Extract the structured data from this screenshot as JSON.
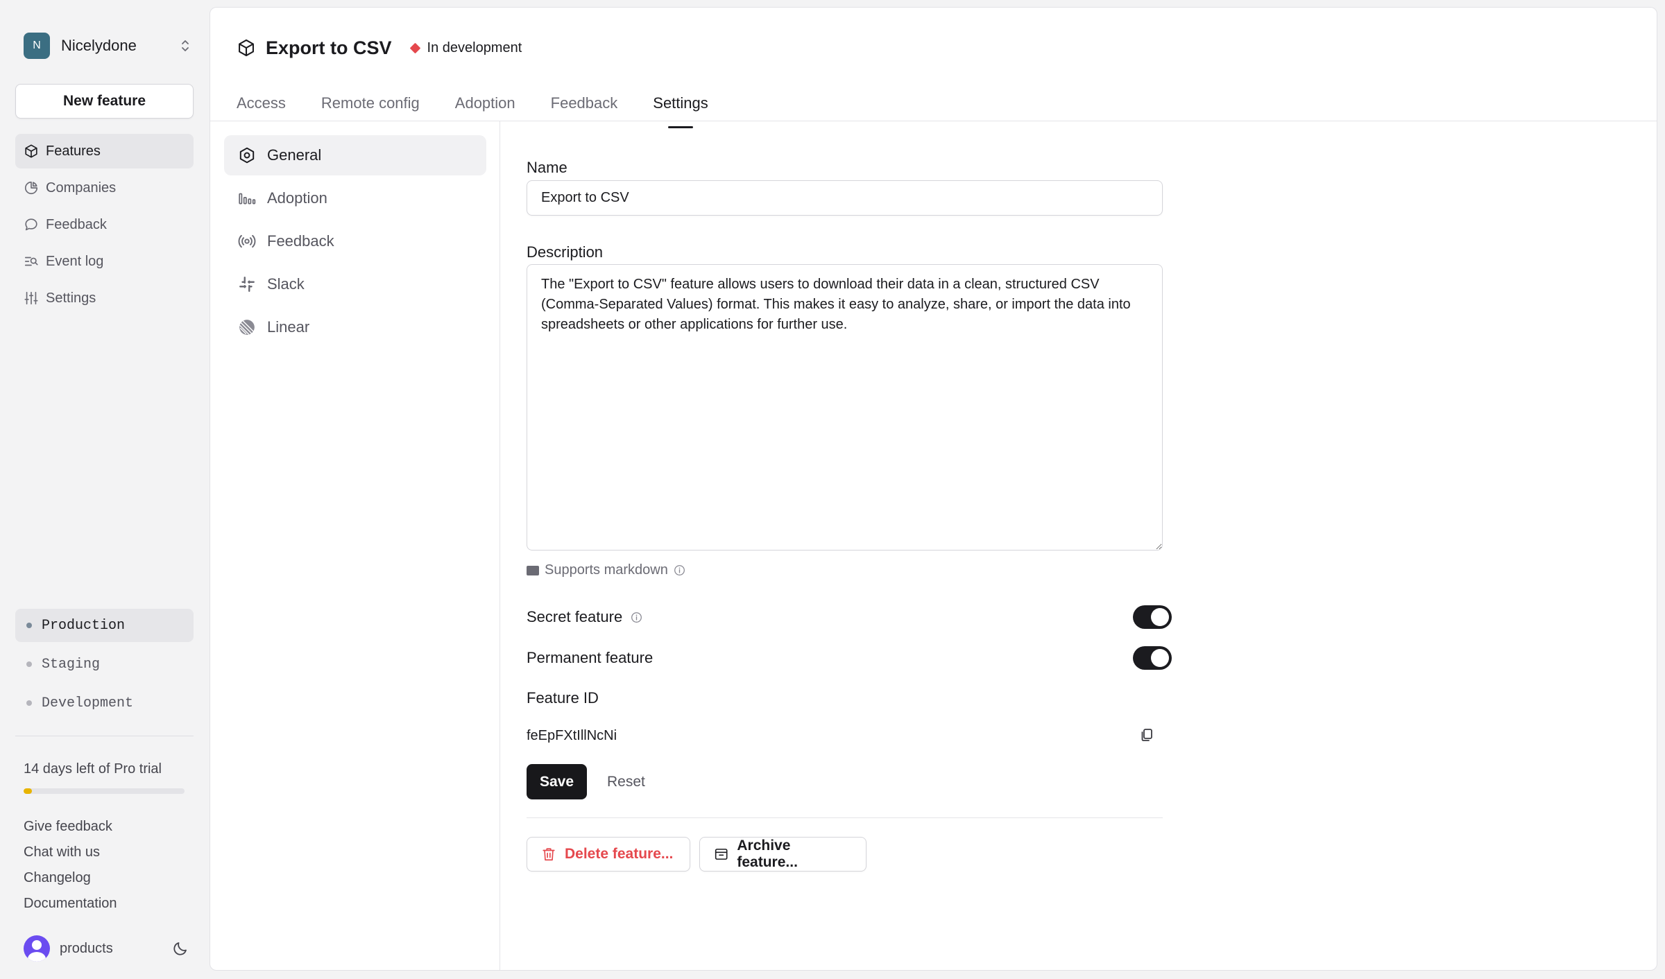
{
  "workspace": {
    "initial": "N",
    "name": "Nicelydone"
  },
  "sidebar": {
    "new_feature_label": "New feature",
    "nav": [
      {
        "label": "Features",
        "icon": "cube-icon",
        "active": true
      },
      {
        "label": "Companies",
        "icon": "pie-chart-icon"
      },
      {
        "label": "Feedback",
        "icon": "chat-bubble-icon"
      },
      {
        "label": "Event log",
        "icon": "event-log-icon"
      },
      {
        "label": "Settings",
        "icon": "sliders-icon"
      }
    ],
    "environments": [
      {
        "label": "Production",
        "active": true
      },
      {
        "label": "Staging"
      },
      {
        "label": "Development"
      }
    ],
    "trial": {
      "text": "14 days left of Pro trial",
      "progress_fraction": 0.05,
      "color": "#e8b400"
    },
    "links": [
      "Give feedback",
      "Chat with us",
      "Changelog",
      "Documentation"
    ],
    "user": {
      "name": "products"
    }
  },
  "header": {
    "title": "Export to CSV",
    "status": "In development",
    "status_color": "#e5484d"
  },
  "tabs": [
    {
      "label": "Access"
    },
    {
      "label": "Remote config"
    },
    {
      "label": "Adoption"
    },
    {
      "label": "Feedback"
    },
    {
      "label": "Settings",
      "active": true
    }
  ],
  "subnav": [
    {
      "label": "General",
      "icon": "settings-hexagon-icon",
      "active": true
    },
    {
      "label": "Adoption",
      "icon": "adoption-bars-icon"
    },
    {
      "label": "Feedback",
      "icon": "feedback-broadcast-icon"
    },
    {
      "label": "Slack",
      "icon": "slack-icon"
    },
    {
      "label": "Linear",
      "icon": "linear-icon"
    }
  ],
  "form": {
    "name_label": "Name",
    "name_value": "Export to CSV",
    "description_label": "Description",
    "description_value": "The \"Export to CSV\" feature allows users to download their data in a clean, structured CSV (Comma-Separated Values) format. This makes it easy to analyze, share, or import the data into spreadsheets or other applications for further use.",
    "markdown_hint": "Supports markdown",
    "secret_label": "Secret feature",
    "secret_on": true,
    "permanent_label": "Permanent feature",
    "permanent_on": true,
    "feature_id_label": "Feature ID",
    "feature_id_value": "feEpFXtIllNcNi",
    "save_label": "Save",
    "reset_label": "Reset",
    "delete_label": "Delete feature...",
    "archive_label": "Archive feature..."
  }
}
